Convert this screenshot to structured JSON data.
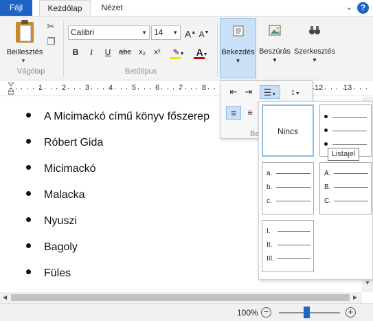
{
  "tabs": {
    "file": "Fájl",
    "home": "Kezdőlap",
    "view": "Nézet"
  },
  "clipboard": {
    "paste_label": "Beillesztés",
    "group_label": "Vágólap"
  },
  "font": {
    "name": "Calibri",
    "size": "14",
    "group_label": "Betűtípus"
  },
  "format_buttons": {
    "bold": "B",
    "italic": "I",
    "underline": "U",
    "strike": "abc",
    "subscript": "x₂",
    "superscript": "x²"
  },
  "paragraph": {
    "label": "Bekezdés",
    "group_label": "Be"
  },
  "insert": {
    "label": "Beszúrás"
  },
  "editing": {
    "label": "Szerkesztés"
  },
  "ruler": [
    "1",
    "2",
    "3",
    "4",
    "5",
    "6",
    "7",
    "8",
    "12",
    "13"
  ],
  "document": {
    "items": [
      "A Micimackó című könyv főszerep",
      "Róbert Gida",
      "Micimackó",
      "Malacka",
      "Nyuszi",
      "Bagoly",
      "Füles"
    ]
  },
  "list_gallery": {
    "none": "Nincs",
    "tooltip": "Listajel",
    "lower_alpha": [
      "a.",
      "b.",
      "c."
    ],
    "upper_alpha": [
      "A.",
      "B.",
      "C."
    ],
    "roman": [
      "I.",
      "II.",
      "III."
    ]
  },
  "status": {
    "zoom": "100%",
    "zoom_level": 0.45
  },
  "colors": {
    "accent": "#1d65c8",
    "selected_bg": "#c9e0f7",
    "font_color": "#cc0000",
    "highlight": "#f2e100"
  }
}
